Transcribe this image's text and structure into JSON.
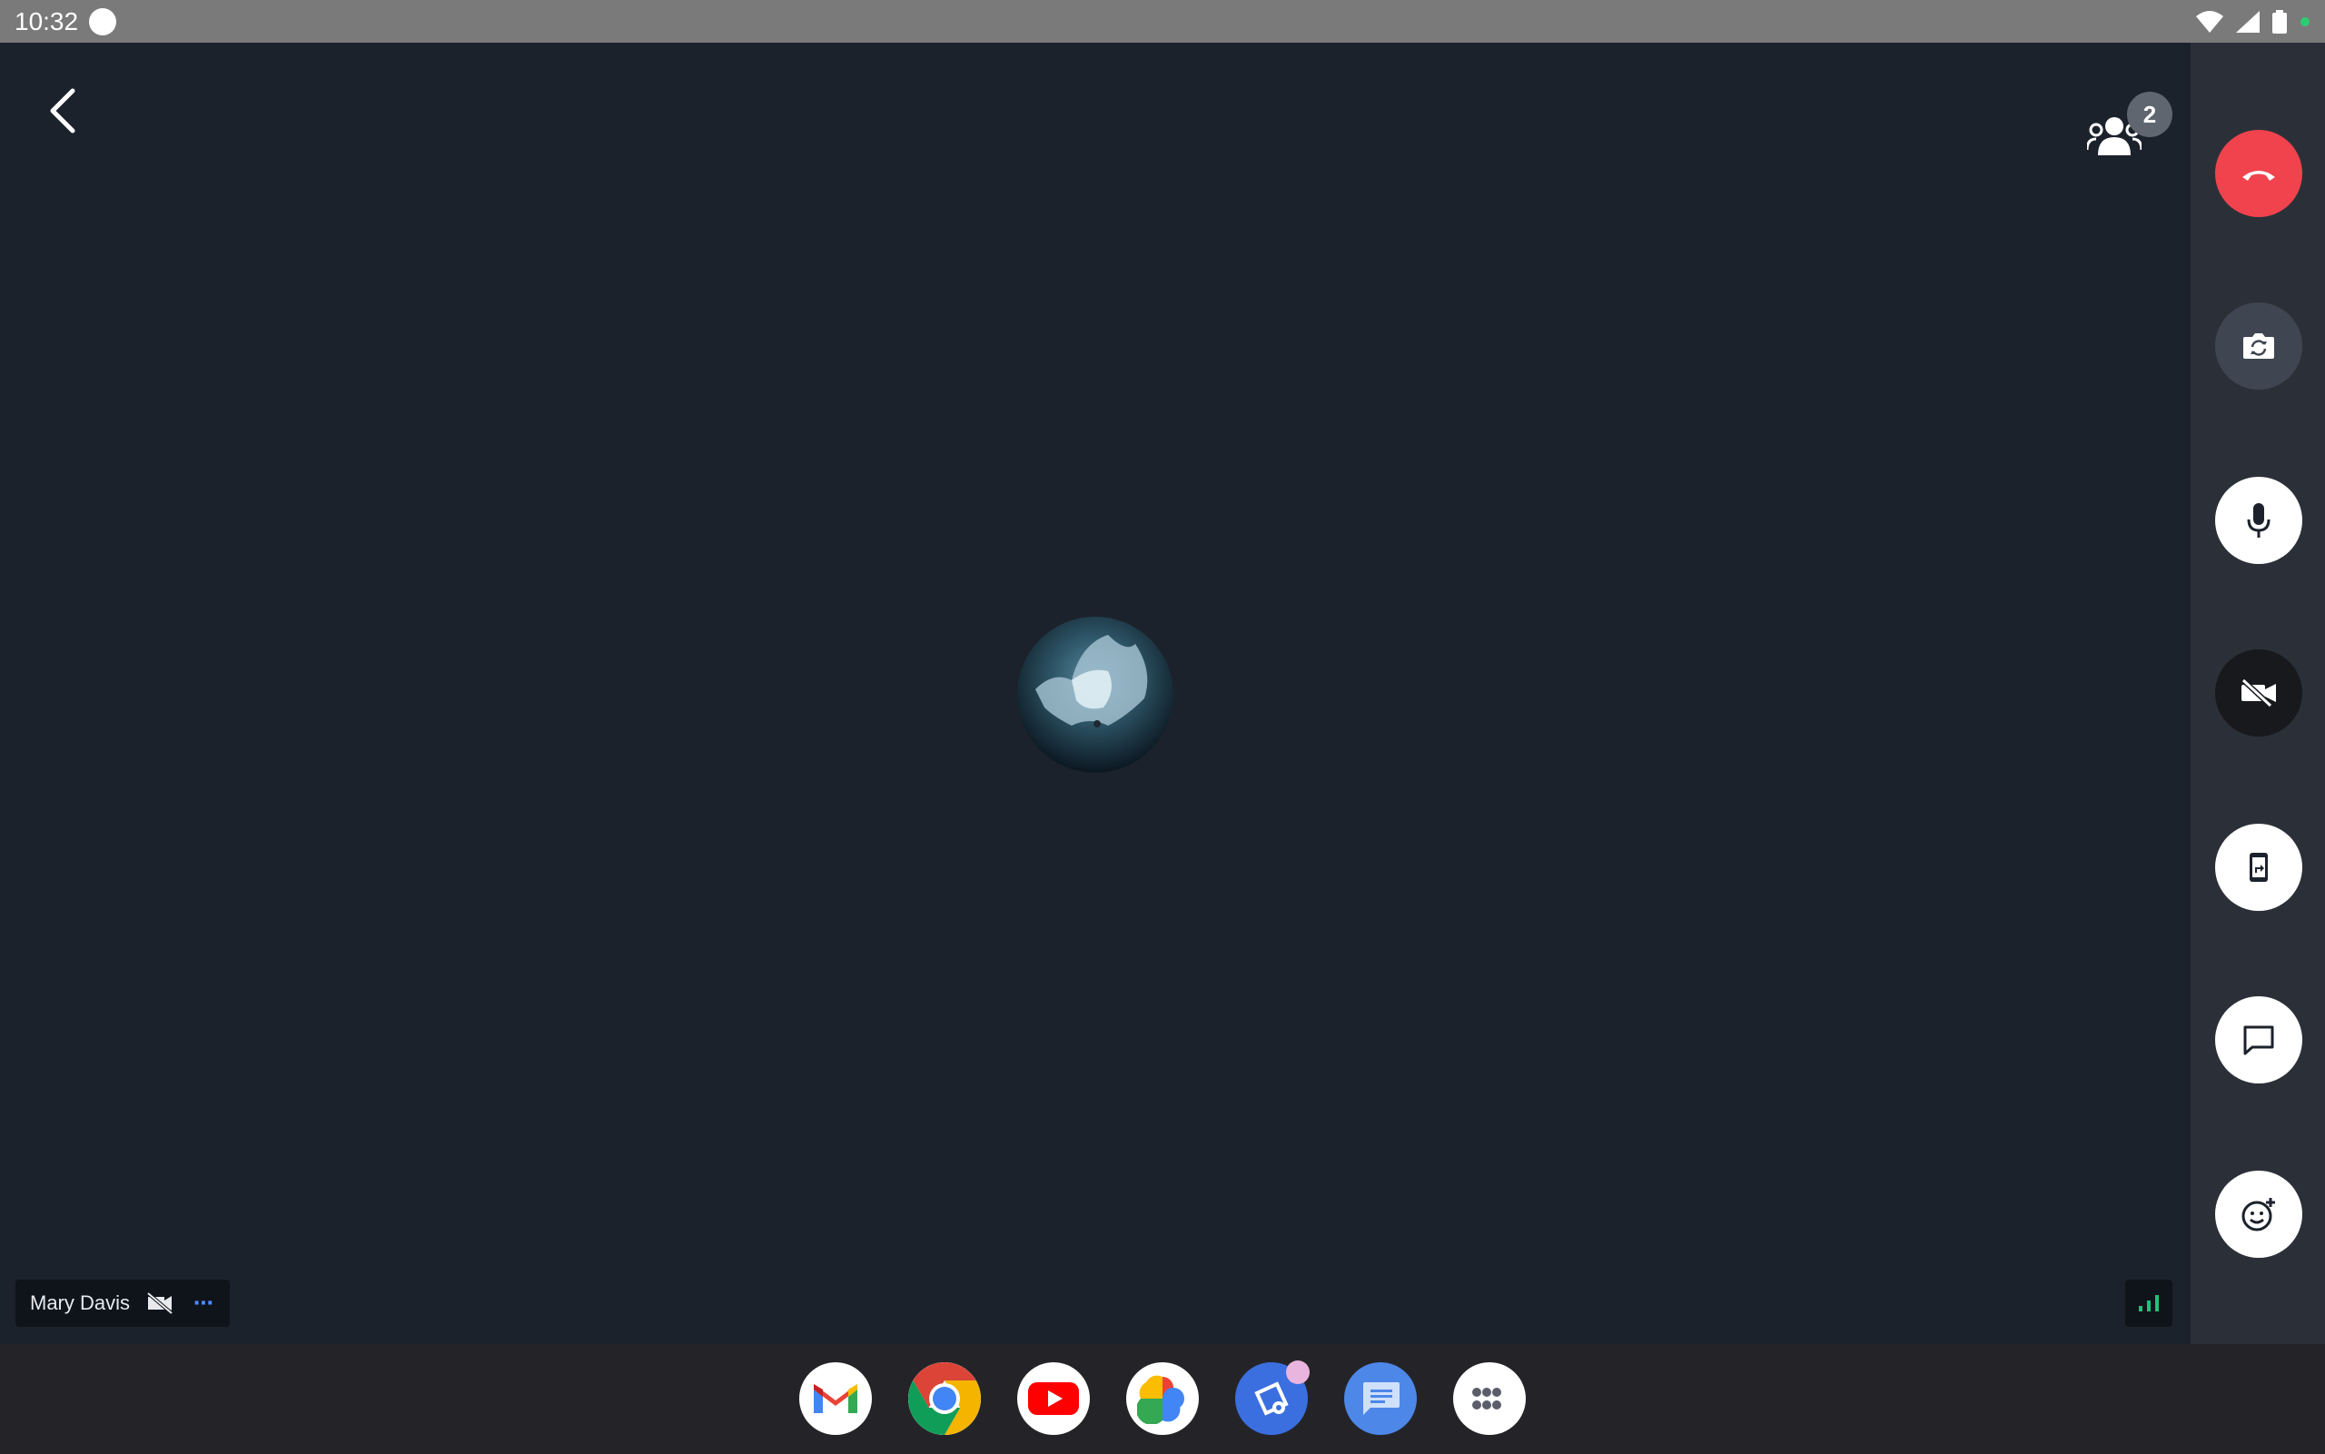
{
  "status_bar": {
    "time": "10:32",
    "icons": [
      "wifi-icon",
      "cellular-icon",
      "battery-icon",
      "active-dot"
    ]
  },
  "header": {
    "back_icon": "chevron-left-icon",
    "participants_icon": "people-icon",
    "participant_count": "2"
  },
  "tile": {
    "participant_name": "Mary Davis",
    "camera_status_icon": "video-off-icon",
    "more_label": "⋯",
    "signal_icon": "signal-bars-icon"
  },
  "controls": [
    {
      "id": "end-call",
      "icon": "phone-hangup-icon",
      "color": "#f0434d"
    },
    {
      "id": "flip-camera",
      "icon": "camera-flip-icon",
      "color": "#3f4651"
    },
    {
      "id": "microphone",
      "icon": "mic-icon",
      "color": "#ffffff"
    },
    {
      "id": "video-toggle",
      "icon": "video-off-icon",
      "color": "#17191d"
    },
    {
      "id": "screen-share",
      "icon": "screen-share-icon",
      "color": "#ffffff"
    },
    {
      "id": "chat",
      "icon": "chat-icon",
      "color": "#ffffff"
    },
    {
      "id": "reactions",
      "icon": "emoji-add-icon",
      "color": "#ffffff"
    }
  ],
  "dock": [
    {
      "app": "Gmail",
      "icon": "gmail-icon"
    },
    {
      "app": "Chrome",
      "icon": "chrome-icon"
    },
    {
      "app": "YouTube",
      "icon": "youtube-icon"
    },
    {
      "app": "Photos",
      "icon": "photos-icon"
    },
    {
      "app": "Meeting",
      "icon": "meeting-app-icon"
    },
    {
      "app": "Messages",
      "icon": "messages-icon"
    },
    {
      "app": "All apps",
      "icon": "app-drawer-icon"
    }
  ],
  "colors": {
    "call_background": "#1c222c",
    "rail_background": "#2b3038",
    "taskbar_background": "#242428",
    "end_call_red": "#f0434d",
    "accent_blue": "#4a8cff",
    "signal_green": "#1ec27a"
  }
}
